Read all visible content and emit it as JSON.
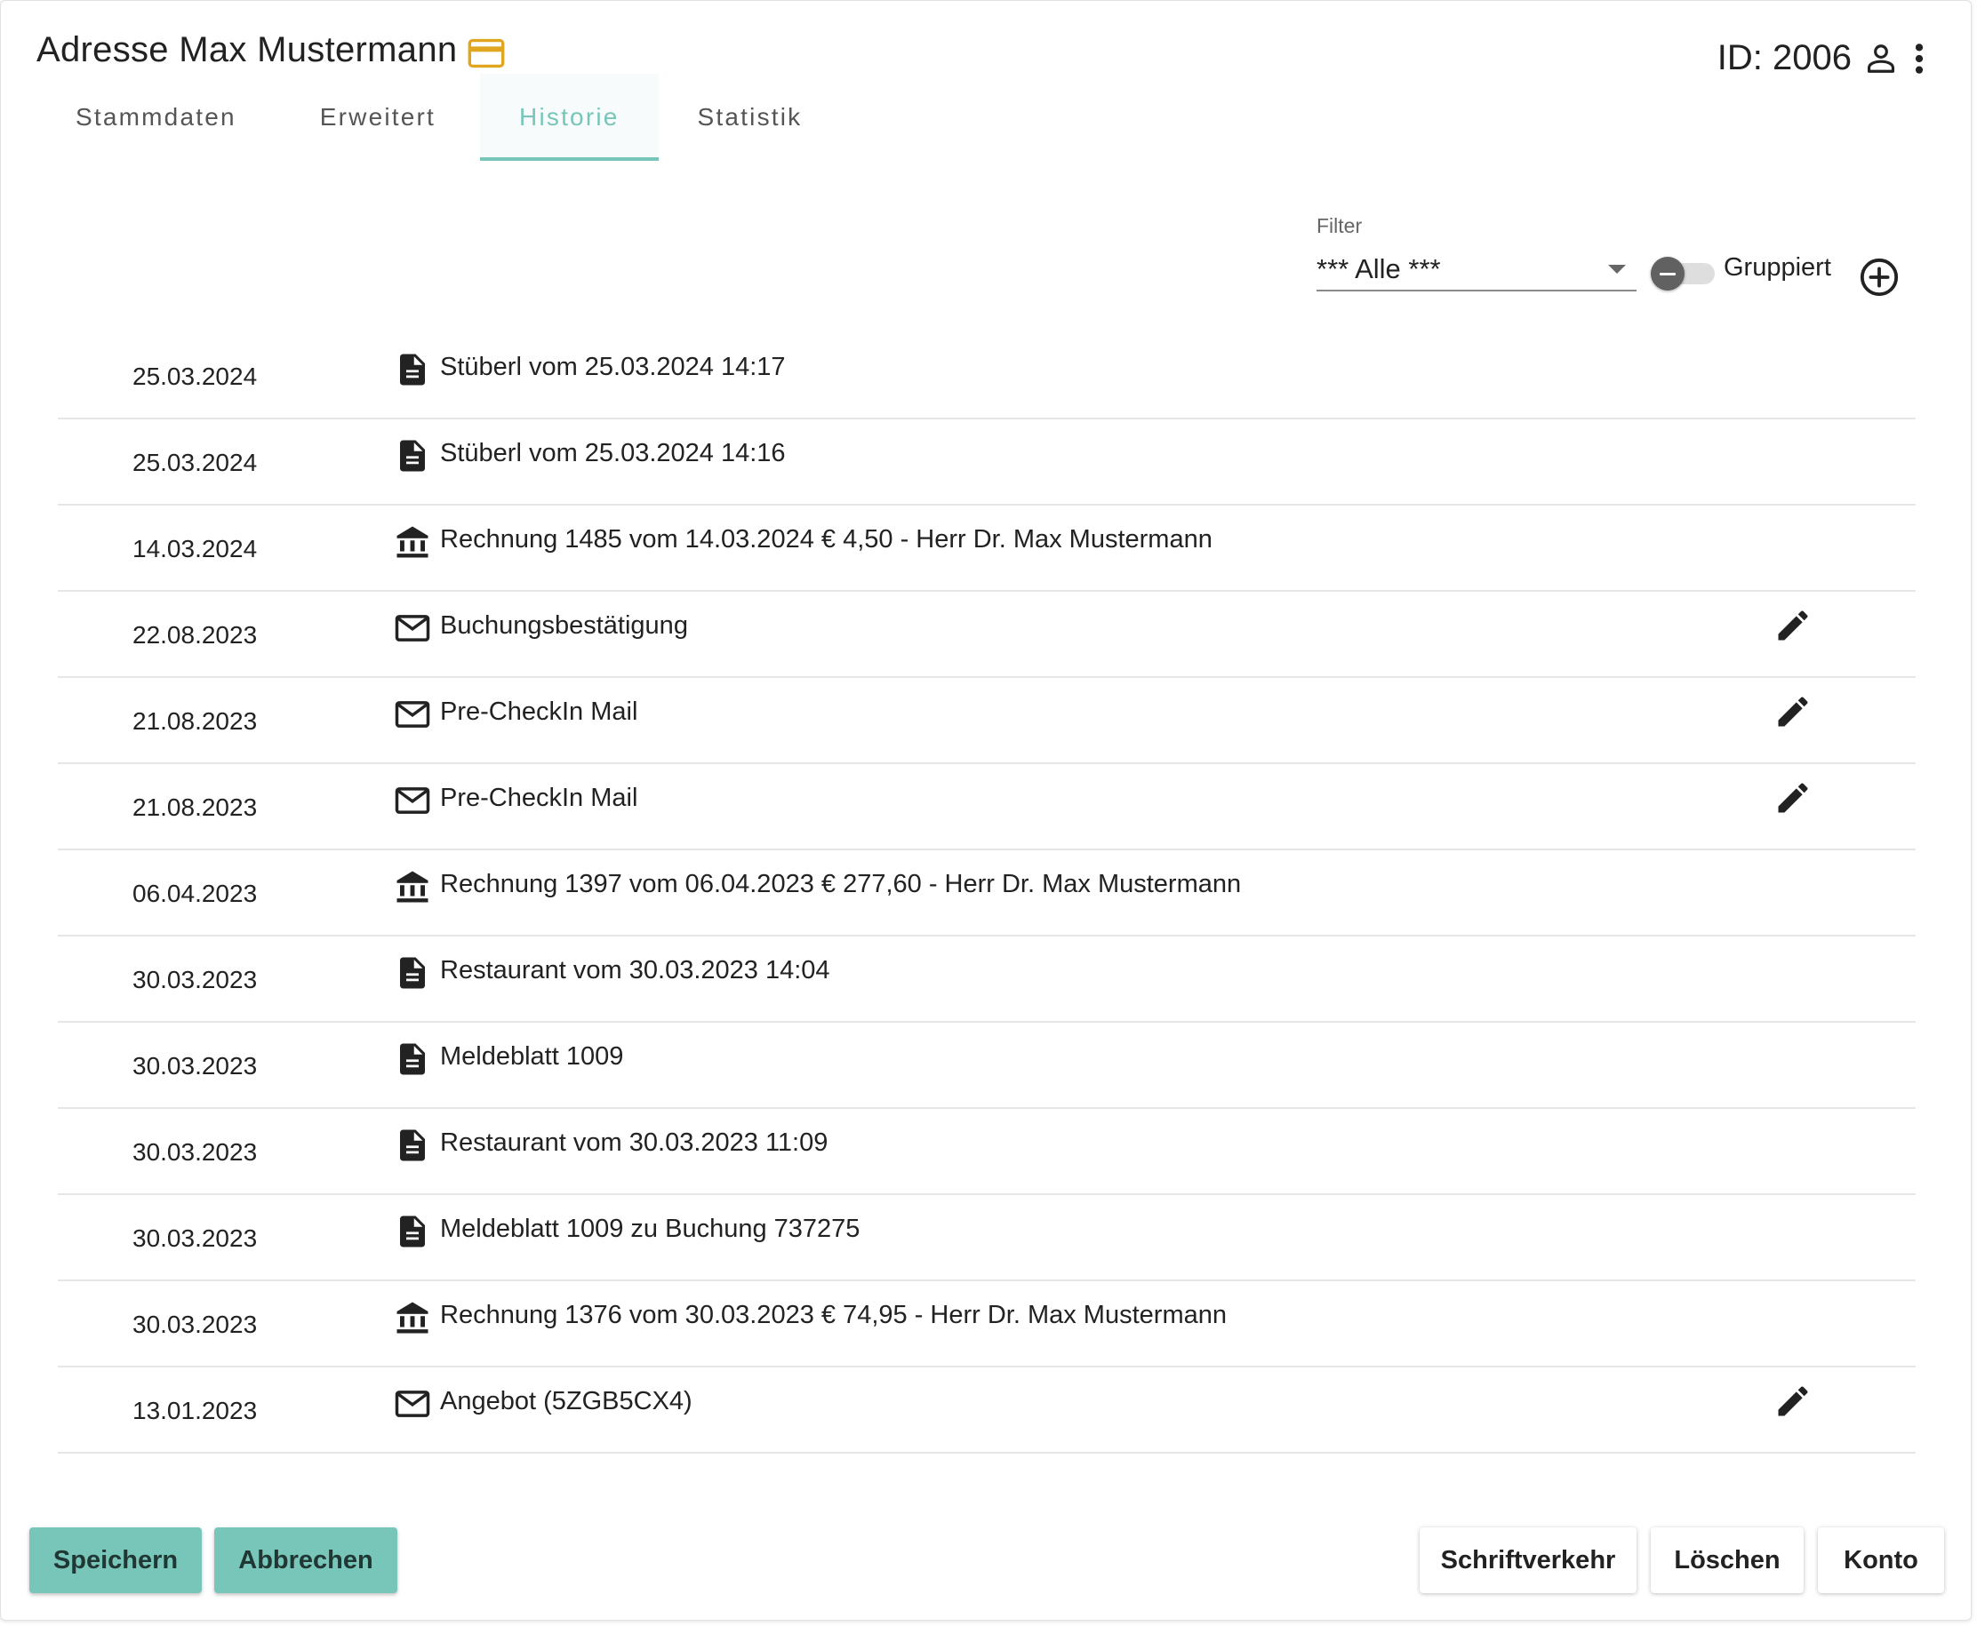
{
  "header": {
    "title": "Adresse Max Mustermann",
    "id_text": "ID: 2006",
    "card_icon": "credit-card-icon",
    "accent_color": "#e0a61f"
  },
  "tabs": [
    {
      "label": "Stammdaten",
      "active": false
    },
    {
      "label": "Erweitert",
      "active": false
    },
    {
      "label": "Historie",
      "active": true
    },
    {
      "label": "Statistik",
      "active": false
    }
  ],
  "filter": {
    "label": "Filter",
    "value": "*** Alle ***",
    "toggle_label": "Gruppiert",
    "toggle_on": false
  },
  "history": [
    {
      "date": "25.03.2024",
      "icon": "document-icon",
      "text": "Stüberl vom 25.03.2024 14:17",
      "editable": false
    },
    {
      "date": "25.03.2024",
      "icon": "document-icon",
      "text": "Stüberl vom 25.03.2024 14:16",
      "editable": false
    },
    {
      "date": "14.03.2024",
      "icon": "bank-icon",
      "text": "Rechnung 1485 vom 14.03.2024 € 4,50 - Herr Dr. Max Mustermann",
      "editable": false
    },
    {
      "date": "22.08.2023",
      "icon": "mail-icon",
      "text": "Buchungsbestätigung",
      "editable": true
    },
    {
      "date": "21.08.2023",
      "icon": "mail-icon",
      "text": "Pre-CheckIn Mail",
      "editable": true
    },
    {
      "date": "21.08.2023",
      "icon": "mail-icon",
      "text": "Pre-CheckIn Mail",
      "editable": true
    },
    {
      "date": "06.04.2023",
      "icon": "bank-icon",
      "text": "Rechnung 1397 vom 06.04.2023 € 277,60 - Herr Dr. Max Mustermann",
      "editable": false
    },
    {
      "date": "30.03.2023",
      "icon": "document-icon",
      "text": "Restaurant vom 30.03.2023 14:04",
      "editable": false
    },
    {
      "date": "30.03.2023",
      "icon": "document-icon",
      "text": "Meldeblatt 1009",
      "editable": false
    },
    {
      "date": "30.03.2023",
      "icon": "document-icon",
      "text": "Restaurant vom 30.03.2023 11:09",
      "editable": false
    },
    {
      "date": "30.03.2023",
      "icon": "document-icon",
      "text": "Meldeblatt 1009 zu Buchung 737275",
      "editable": false
    },
    {
      "date": "30.03.2023",
      "icon": "bank-icon",
      "text": "Rechnung 1376 vom 30.03.2023 € 74,95 - Herr Dr. Max Mustermann",
      "editable": false
    },
    {
      "date": "13.01.2023",
      "icon": "mail-icon",
      "text": "Angebot (5ZGB5CX4)",
      "editable": true
    }
  ],
  "buttons": {
    "save": "Speichern",
    "cancel": "Abbrechen",
    "correspondence": "Schriftverkehr",
    "delete": "Löschen",
    "account": "Konto"
  },
  "colors": {
    "accent": "#78c6ba"
  }
}
